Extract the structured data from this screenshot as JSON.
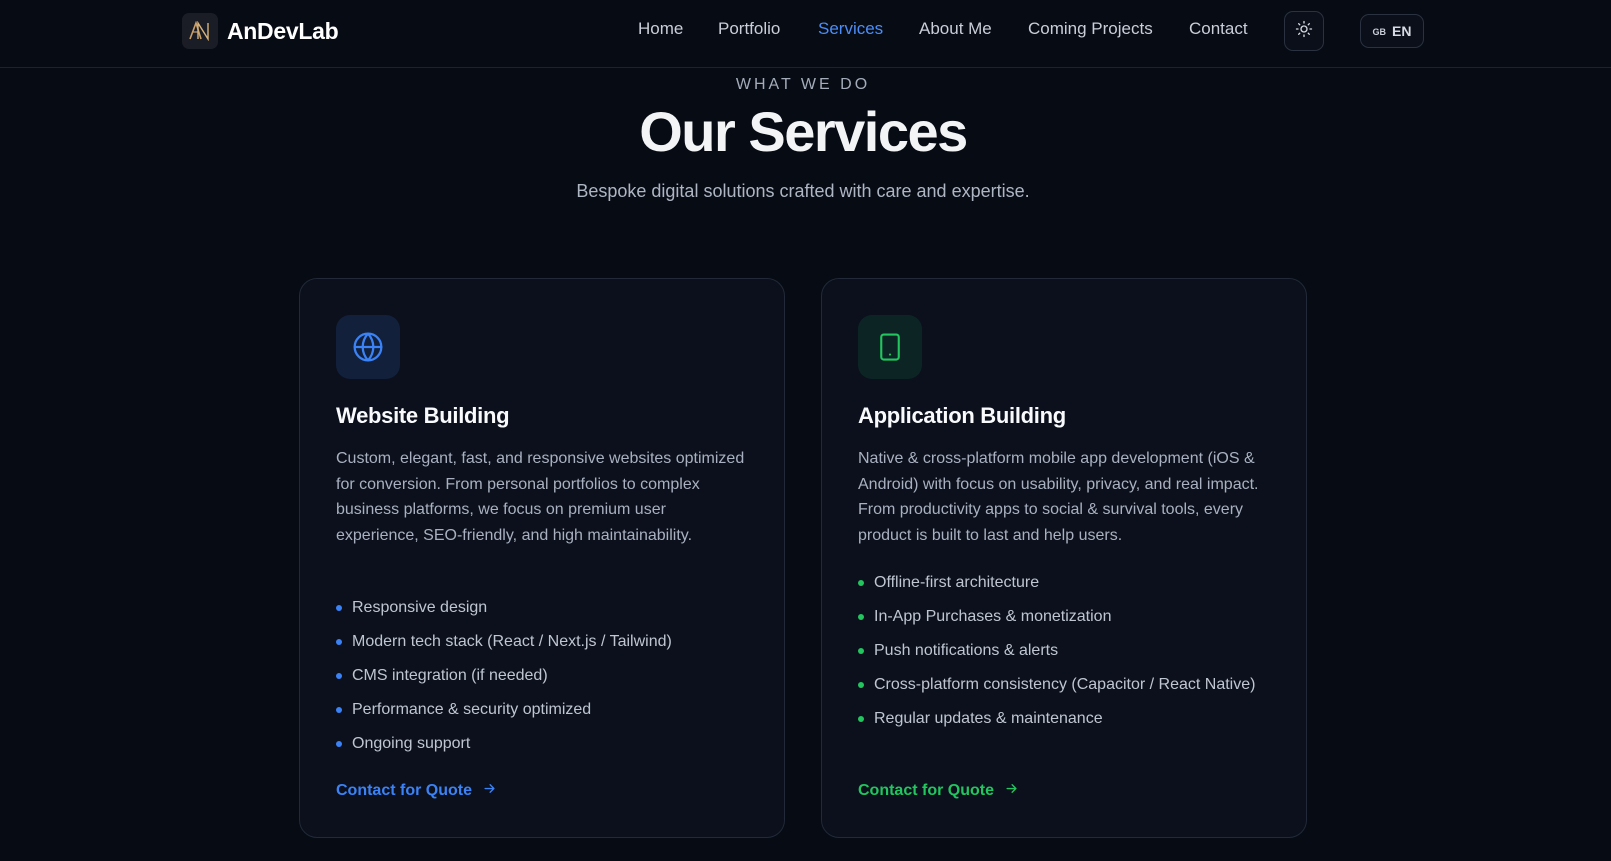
{
  "brand": {
    "name": "AnDevLab",
    "logo_icon": "an-monogram-icon",
    "logo_color": "#c9a06a"
  },
  "nav": {
    "items": [
      {
        "label": "Home",
        "active": false
      },
      {
        "label": "Portfolio",
        "active": false
      },
      {
        "label": "Services",
        "active": true
      },
      {
        "label": "About Me",
        "active": false
      },
      {
        "label": "Coming Projects",
        "active": false
      },
      {
        "label": "Contact",
        "active": false
      }
    ],
    "active_color": "#4b8df8",
    "theme_toggle_icon": "sun-icon",
    "language": {
      "flag": "GB",
      "code": "EN"
    }
  },
  "hero": {
    "eyebrow": "WHAT WE DO",
    "title": "Our Services",
    "subtitle": "Bespoke digital solutions crafted with care and expertise."
  },
  "services": [
    {
      "icon": "globe-icon",
      "accent": "#3b82f6",
      "title": "Website Building",
      "description": "Custom, elegant, fast, and responsive websites optimized for conversion. From personal portfolios to complex business platforms, we focus on premium user experience, SEO-friendly, and high maintainability.",
      "features": [
        "Responsive design",
        "Modern tech stack (React / Next.js / Tailwind)",
        "CMS integration (if needed)",
        "Performance & security optimized",
        "Ongoing support"
      ],
      "cta": "Contact for Quote"
    },
    {
      "icon": "smartphone-icon",
      "accent": "#22c55e",
      "title": "Application Building",
      "description": "Native & cross-platform mobile app development (iOS & Android) with focus on usability, privacy, and real impact. From productivity apps to social & survival tools, every product is built to last and help users.",
      "features": [
        "Offline-first architecture",
        "In-App Purchases & monetization",
        "Push notifications & alerts",
        "Cross-platform consistency (Capacitor / React Native)",
        "Regular updates & maintenance"
      ],
      "cta": "Contact for Quote"
    }
  ]
}
